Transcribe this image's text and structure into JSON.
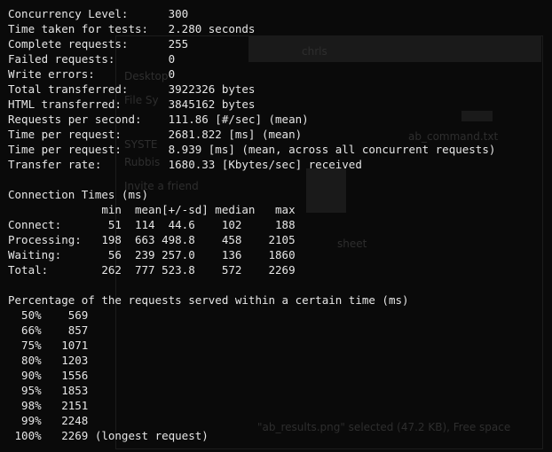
{
  "background": {
    "ghost_texts": [
      "Desktop",
      "File Sy",
      "ab_results.png",
      "chrls",
      "ab_command.txt",
      "SYSTE",
      "Rubbis",
      "Invite a friend",
      "sheet",
      "\"ab_results.png\" selected (47.2 KB), Free space"
    ]
  },
  "terminal": {
    "lines": [
      "Concurrency Level:      300",
      "Time taken for tests:   2.280 seconds",
      "Complete requests:      255",
      "Failed requests:        0",
      "Write errors:           0",
      "Total transferred:      3922326 bytes",
      "HTML transferred:       3845162 bytes",
      "Requests per second:    111.86 [#/sec] (mean)",
      "Time per request:       2681.822 [ms] (mean)",
      "Time per request:       8.939 [ms] (mean, across all concurrent requests)",
      "Transfer rate:          1680.33 [Kbytes/sec] received",
      "",
      "Connection Times (ms)",
      "              min  mean[+/-sd] median   max",
      "Connect:       51  114  44.6    102     188",
      "Processing:   198  663 498.8    458    2105",
      "Waiting:       56  239 257.0    136    1860",
      "Total:        262  777 523.8    572    2269",
      "",
      "Percentage of the requests served within a certain time (ms)",
      "  50%    569",
      "  66%    857",
      "  75%   1071",
      "  80%   1203",
      "  90%   1556",
      "  95%   1853",
      "  98%   2151",
      "  99%   2248",
      " 100%   2269 (longest request)"
    ]
  }
}
